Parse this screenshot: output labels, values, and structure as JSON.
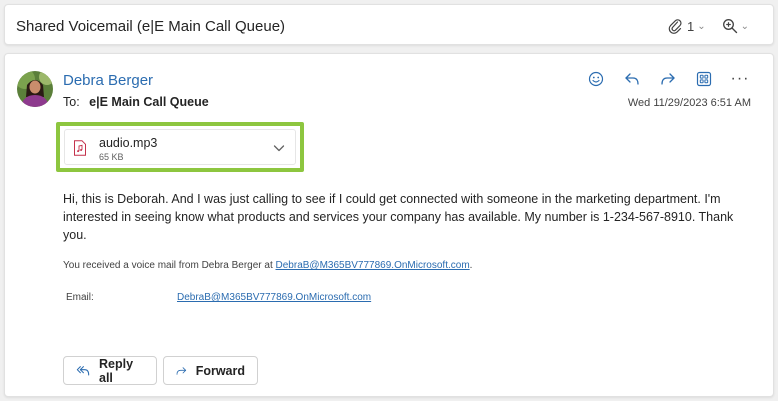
{
  "subject": {
    "title": "Shared Voicemail (e|E Main Call Queue)",
    "attachment_count": "1"
  },
  "message": {
    "sender": "Debra Berger",
    "to_label": "To:",
    "recipient": "e|E Main Call Queue",
    "date": "Wed 11/29/2023 6:51 AM",
    "attachment": {
      "name": "audio.mp3",
      "size": "65 KB"
    },
    "body": "Hi, this is Deborah. And I was just calling to see if I could get connected with someone in the marketing department. I'm interested in seeing know what products and services your company has available. My number is 1-234-567-8910. Thank you.",
    "notice_prefix": "You received a voice mail from Debra Berger at ",
    "notice_link": "DebraB@M365BV777869.OnMicrosoft.com",
    "notice_suffix": ".",
    "email_label": "Email:",
    "email_value": "DebraB@M365BV777869.OnMicrosoft.com"
  },
  "buttons": {
    "reply_all": "Reply all",
    "forward": "Forward"
  },
  "colors": {
    "accent": "#2b6cb0",
    "highlight": "#8dc63f"
  },
  "icons": [
    "paperclip-icon",
    "zoom-icon",
    "emoji-icon",
    "reply-icon",
    "forward-icon",
    "apps-icon",
    "more-icon",
    "audio-file-icon",
    "chevron-down-icon"
  ]
}
